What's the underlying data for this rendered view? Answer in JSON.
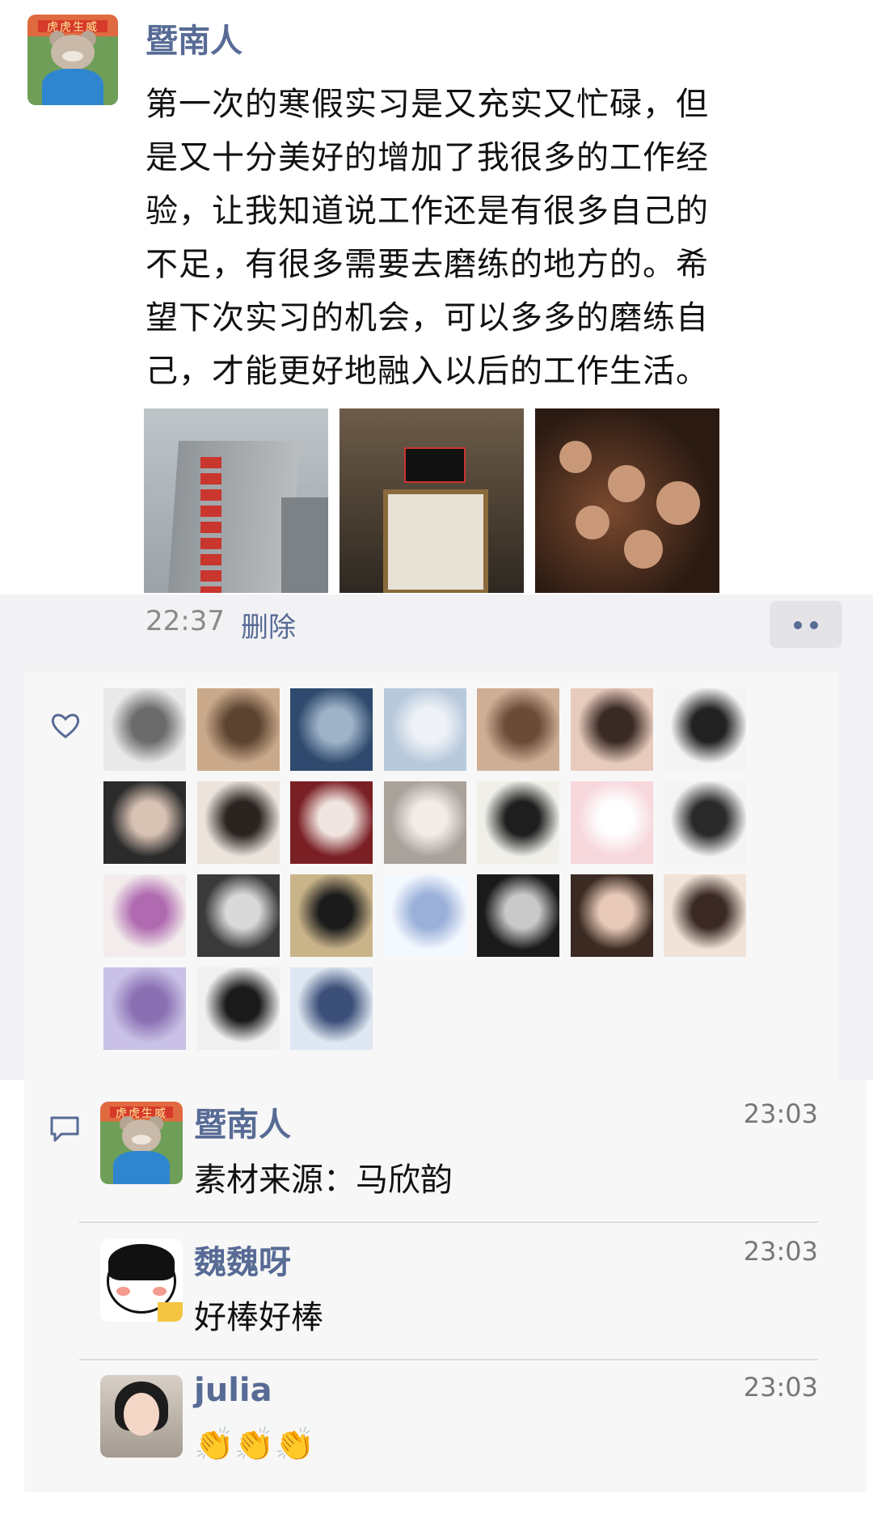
{
  "post": {
    "author": "暨南人",
    "avatar_banner": "虎虎生威",
    "text": "第一次的寒假实习是又充实又忙碌，但\n是又十分美好的增加了我很多的工作经\n验，让我知道说工作还是有很多自己的\n不足，有很多需要去磨练的地方的。希\n望下次实习的机会，可以多多的磨练自\n己，才能更好地融入以后的工作生活。",
    "time": "22:37",
    "delete_label": "删除",
    "photos": [
      "building-photo",
      "office-door-photo",
      "group-selfie-photo"
    ]
  },
  "likes": {
    "icon": "heart-icon",
    "count": 24
  },
  "comments": [
    {
      "name": "暨南人",
      "text": "素材来源：马欣韵",
      "time": "23:03"
    },
    {
      "name": "魏魏呀",
      "text": "好棒好棒",
      "time": "23:03"
    },
    {
      "name": "julia",
      "text": "👏👏👏",
      "time": "23:03"
    }
  ],
  "colors": {
    "link": "#576b95",
    "panel": "#f7f7f7",
    "shade": "#f2f2f5"
  }
}
